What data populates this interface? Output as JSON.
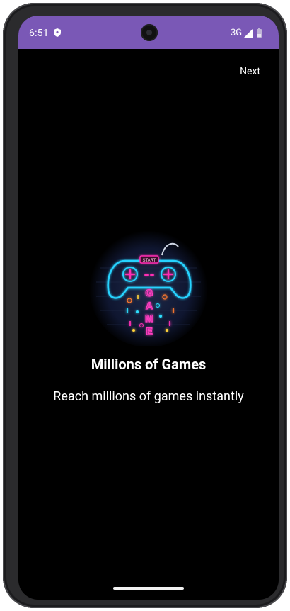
{
  "status_bar": {
    "time": "6:51",
    "network": "3G",
    "color": "#7a58b6",
    "icons": [
      "shield-icon",
      "signal-icon",
      "battery-icon"
    ]
  },
  "header": {
    "next_label": "Next"
  },
  "hero": {
    "image": "neon-gamepad-illustration",
    "badge": "START",
    "letters": [
      "G",
      "A",
      "M",
      "E"
    ]
  },
  "content": {
    "title": "Millions of Games",
    "subtitle": "Reach millions of games instantly"
  },
  "colors": {
    "background": "#000000",
    "text": "#ffffff",
    "neon_cyan": "#26d4ff",
    "neon_pink": "#ff2fb4"
  }
}
